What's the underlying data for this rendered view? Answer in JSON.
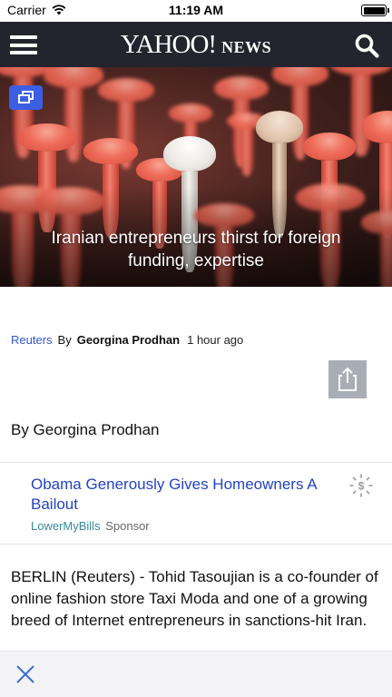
{
  "status_bar": {
    "carrier": "Carrier",
    "time": "11:19 AM"
  },
  "header": {
    "logo_main": "YAHOO!",
    "logo_sub": "NEWS",
    "menu_icon": "hamburger-menu-icon",
    "search_icon": "search-icon",
    "background_color": "#24242f"
  },
  "hero": {
    "caption": "Iranian entrepreneurs thirst for foreign funding, expertise",
    "gallery_icon": "gallery-icon"
  },
  "article_meta": {
    "source": "Reuters",
    "by_prefix": "By",
    "author": "Georgina Prodhan",
    "time_ago": "1 hour ago"
  },
  "share": {
    "icon": "share-icon"
  },
  "byline": "By Georgina Prodhan",
  "sponsored": {
    "title": "Obama Generously Gives Homeowners A Bailout",
    "sponsor_name": "LowerMyBills",
    "sponsor_label": "Sponsor",
    "icon": "dollar-badge-icon",
    "title_color": "#2342c5",
    "sponsor_color": "#338a9b"
  },
  "body": {
    "paragraph": "BERLIN (Reuters) - Tohid Tasoujian is a co-founder of online fashion store Taxi Moda and one of a growing breed of Internet entrepreneurs in sanctions-hit Iran."
  },
  "bottom_bar": {
    "close_icon": "close-icon",
    "accent_color": "#3b6fd8"
  }
}
